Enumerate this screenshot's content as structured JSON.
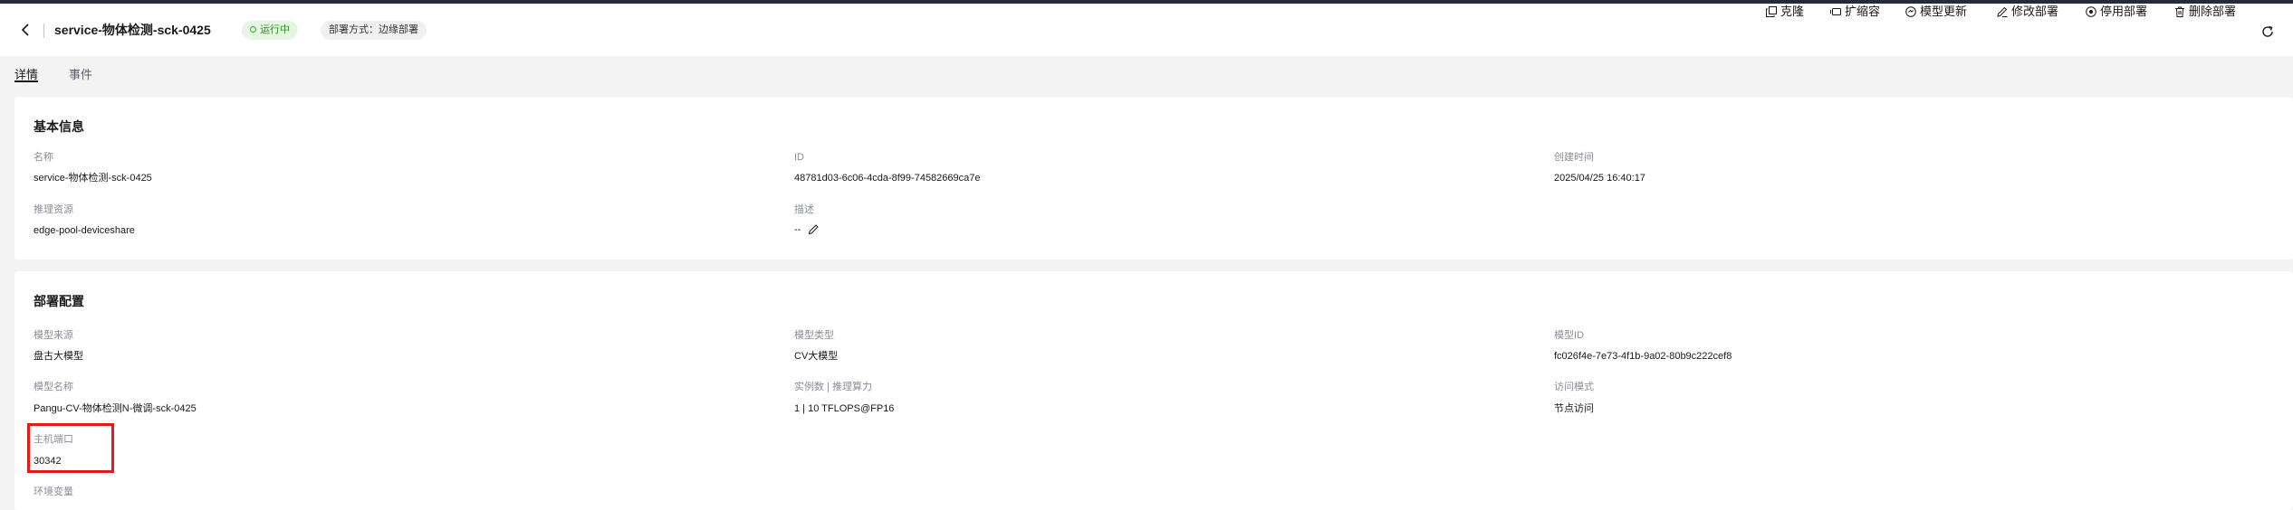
{
  "header": {
    "title": "service-物体检测-sck-0425",
    "status": "运行中",
    "deploy_mode": "部署方式：边缘部署",
    "actions": [
      {
        "label": "克隆",
        "icon": "clone-icon"
      },
      {
        "label": "扩缩容",
        "icon": "scale-icon"
      },
      {
        "label": "模型更新",
        "icon": "model-update-icon"
      },
      {
        "label": "修改部署",
        "icon": "edit-icon"
      },
      {
        "label": "停用部署",
        "icon": "stop-icon"
      },
      {
        "label": "删除部署",
        "icon": "trash-icon"
      }
    ],
    "colors": {
      "running": "#2c8d29",
      "highlight": "#e21a1a"
    }
  },
  "tabs": [
    "详情",
    "事件"
  ],
  "basic_info": {
    "title": "基本信息",
    "fields": [
      {
        "label": "名称",
        "value": "service-物体检测-sck-0425"
      },
      {
        "label": "ID",
        "value": "48781d03-6c06-4cda-8f99-74582669ca7e"
      },
      {
        "label": "创建时间",
        "value": "2025/04/25 16:40:17"
      },
      {
        "label": "推理资源",
        "value": "edge-pool-deviceshare"
      },
      {
        "label": "描述",
        "value": "--"
      }
    ]
  },
  "deploy_config": {
    "title": "部署配置",
    "fields": [
      {
        "label": "模型来源",
        "value": "盘古大模型"
      },
      {
        "label": "模型类型",
        "value": "CV大模型"
      },
      {
        "label": "模型ID",
        "value": "fc026f4e-7e73-4f1b-9a02-80b9c222cef8"
      },
      {
        "label": "模型名称",
        "value": "Pangu-CV-物体检测N-微调-sck-0425"
      },
      {
        "label": "实例数 | 推理算力",
        "value": "1 | 10 TFLOPS@FP16"
      },
      {
        "label": "访问模式",
        "value": "节点访问"
      },
      {
        "label": "主机端口",
        "value": "30342"
      },
      {
        "label": "环境变量",
        "value": ""
      }
    ]
  }
}
